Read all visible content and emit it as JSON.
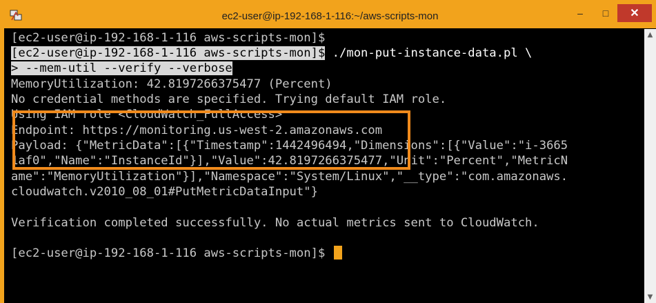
{
  "window": {
    "title": "ec2-user@ip-192-168-1-116:~/aws-scripts-mon",
    "icon": "putty-icon",
    "buttons": {
      "minimize": "–",
      "maximize": "□",
      "close": "✕"
    }
  },
  "terminal": {
    "lines": [
      "[ec2-user@ip-192-168-1-116 aws-scripts-mon]$",
      "[ec2-user@ip-192-168-1-116 aws-scripts-mon]$",
      " ./mon-put-instance-data.pl \\",
      "> --mem-util --verify --verbose",
      "MemoryUtilization: 42.8197266375477 (Percent)",
      "No credential methods are specified. Trying default IAM role.",
      "Using IAM role <CloudWatch_FullAccess>",
      "Endpoint: https://monitoring.us-west-2.amazonaws.com",
      "Payload: {\"MetricData\":[{\"Timestamp\":1442496494,\"Dimensions\":[{\"Value\":\"i-3665",
      "1af0\",\"Name\":\"InstanceId\"}],\"Value\":42.8197266375477,\"Unit\":\"Percent\",\"MetricN",
      "ame\":\"MemoryUtilization\"}],\"Namespace\":\"System/Linux\",\"__type\":\"com.amazonaws.",
      "cloudwatch.v2010_08_01#PutMetricDataInput\"}",
      "",
      "Verification completed successfully. No actual metrics sent to CloudWatch.",
      "",
      "[ec2-user@ip-192-168-1-116 aws-scripts-mon]$ "
    ]
  },
  "colors": {
    "title_bar": "#f2a31c",
    "highlight_border": "#f08a1c",
    "cursor": "#f2a31c",
    "terminal_bg": "#000000",
    "terminal_fg": "#c8c8c8"
  }
}
